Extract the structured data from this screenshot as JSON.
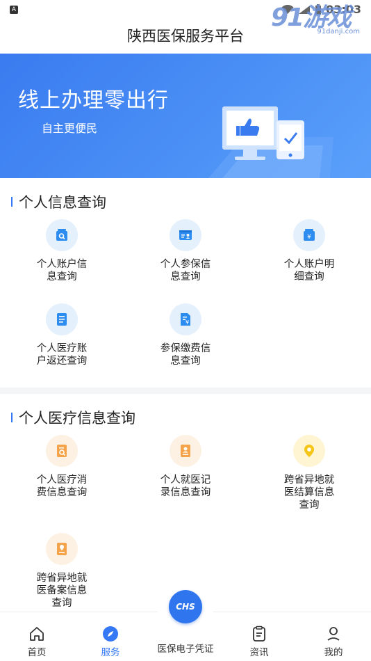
{
  "status_bar": {
    "indicator": "A",
    "time": "03:03"
  },
  "watermark": {
    "brand": "91游戏",
    "site": "91danji.com"
  },
  "header": {
    "title": "陕西医保服务平台"
  },
  "banner": {
    "title": "线上办理零出行",
    "subtitle": "自主更便民"
  },
  "section_personal_info": {
    "title": "个人信息查询",
    "items": [
      {
        "label": "个人账户信息查询",
        "icon": "account-search-icon"
      },
      {
        "label": "个人参保信息查询",
        "icon": "insurance-card-icon"
      },
      {
        "label": "个人账户明细查询",
        "icon": "account-detail-icon"
      },
      {
        "label": "个人医疗账户返还查询",
        "icon": "document-list-icon"
      },
      {
        "label": "参保缴费信息查询",
        "icon": "payment-document-icon"
      }
    ]
  },
  "section_medical_info": {
    "title": "个人医疗信息查询",
    "items": [
      {
        "label": "个人医疗消费信息查询",
        "icon": "consumption-search-icon"
      },
      {
        "label": "个人就医记录信息查询",
        "icon": "medical-record-icon"
      },
      {
        "label": "跨省异地就医结算信息查询",
        "icon": "location-pin-icon"
      },
      {
        "label": "跨省异地就医备案信息查询",
        "icon": "registration-pin-icon"
      }
    ]
  },
  "tabbar": {
    "tabs": [
      {
        "label": "首页",
        "icon": "home-icon"
      },
      {
        "label": "服务",
        "icon": "compass-icon"
      },
      {
        "label": "医保电子凭证",
        "icon": "chs-scan-icon"
      },
      {
        "label": "资讯",
        "icon": "news-icon"
      },
      {
        "label": "我的",
        "icon": "user-icon"
      }
    ],
    "fab_text": "CHS",
    "active_color": "#3478f6"
  },
  "colors": {
    "accent": "#3478f6",
    "banner": "#4a8ff5",
    "icon_blue": "#2d8cf0",
    "icon_orange": "#f5a34a",
    "icon_yellow": "#f5c518"
  }
}
